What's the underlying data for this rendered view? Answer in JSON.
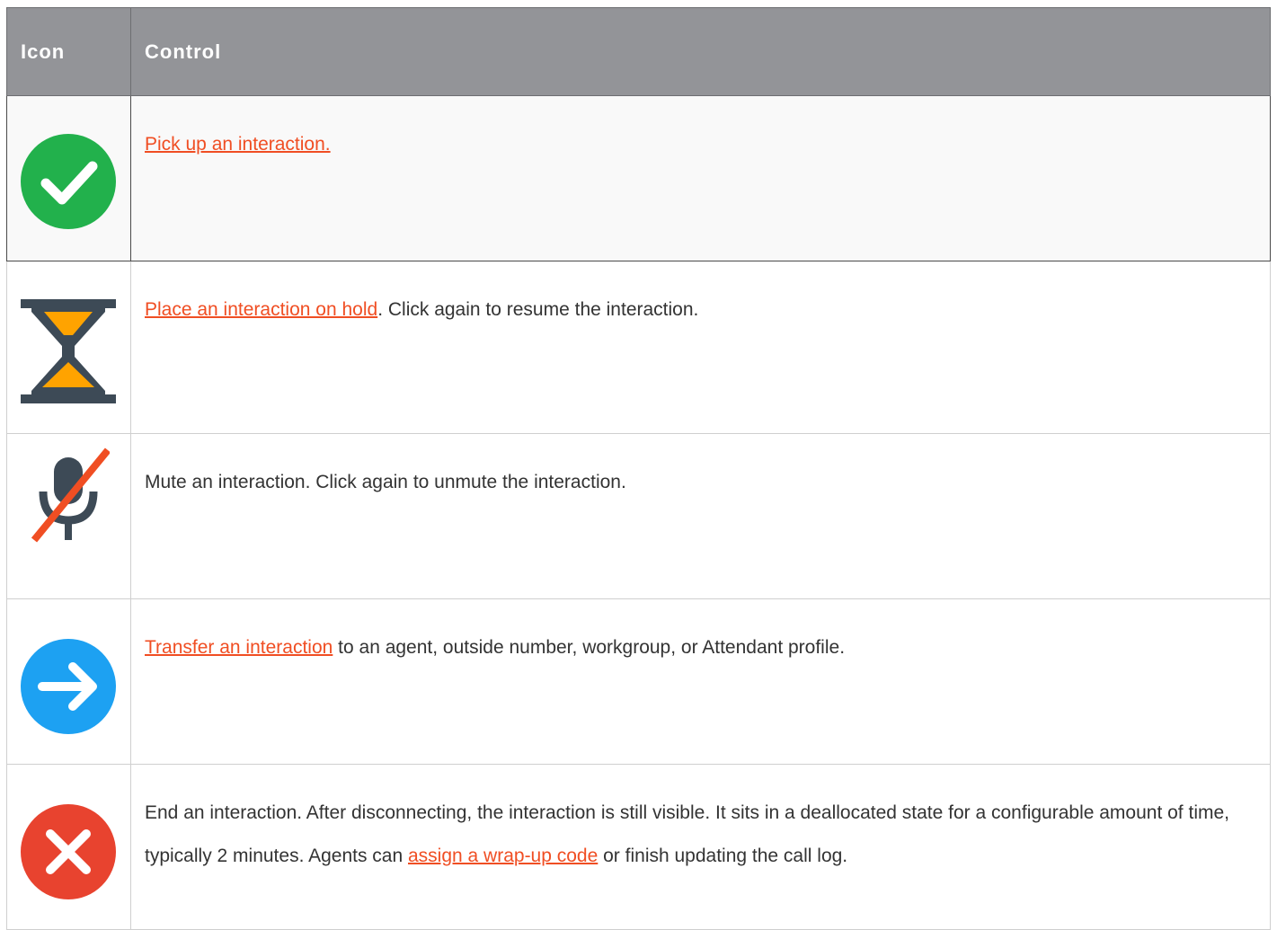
{
  "table": {
    "headers": {
      "icon": "Icon",
      "control": "Control"
    },
    "rows": [
      {
        "icon": "check-circle-icon",
        "link": "Pick up an interaction.",
        "text": ""
      },
      {
        "icon": "hourglass-icon",
        "link": "Place an interaction on hold",
        "text": ". Click again to resume the interaction."
      },
      {
        "icon": "muted-microphone-icon",
        "text": "Mute an interaction. Click again to unmute the interaction."
      },
      {
        "icon": "arrow-right-circle-icon",
        "link": "Transfer an interaction",
        "text": " to an agent, outside number, workgroup, or Attendant profile."
      },
      {
        "icon": "x-circle-icon",
        "text_before": "End an interaction. After disconnecting, the interaction is still visible. It sits in a deallocated state for a configurable amount of time, typically 2 minutes. Agents can ",
        "link": "assign a wrap-up code",
        "text_after": " or finish updating the call log."
      }
    ]
  },
  "colors": {
    "header_bg": "#939498",
    "link": "#f04e23",
    "pickup_green": "#22b14c",
    "hold_dark": "#3d4a56",
    "hold_orange": "#ffa300",
    "transfer_blue": "#1da1f2",
    "disconnect_red": "#e8432f"
  }
}
